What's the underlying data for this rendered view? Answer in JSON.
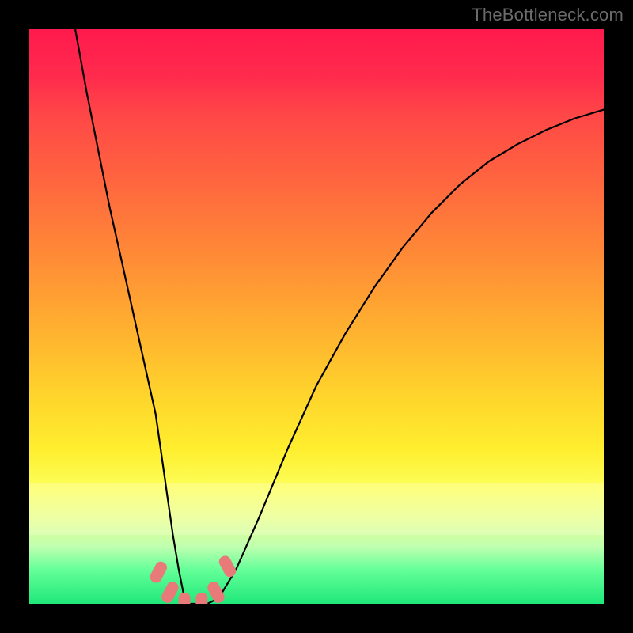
{
  "watermark": "TheBottleneck.com",
  "chart_data": {
    "type": "line",
    "title": "",
    "xlabel": "",
    "ylabel": "",
    "xlim": [
      0,
      100
    ],
    "ylim": [
      0,
      100
    ],
    "series": [
      {
        "name": "curve",
        "x": [
          8,
          10,
          12,
          14,
          16,
          18,
          20,
          22,
          23,
          24,
          25,
          26,
          27,
          28,
          29,
          30,
          31,
          33,
          36,
          40,
          45,
          50,
          55,
          60,
          65,
          70,
          75,
          80,
          85,
          90,
          95,
          100
        ],
        "values": [
          100,
          89,
          79,
          69,
          60,
          51,
          42,
          33,
          26,
          19,
          12,
          6,
          1,
          0,
          0,
          0,
          0,
          1,
          6,
          15,
          27,
          38,
          47,
          55,
          62,
          68,
          73,
          77,
          80,
          82.5,
          84.5,
          86
        ]
      }
    ],
    "markers": [
      {
        "x": 22.5,
        "y": 5.5
      },
      {
        "x": 24.5,
        "y": 2.0
      },
      {
        "x": 27.0,
        "y": 0.0
      },
      {
        "x": 30.0,
        "y": 0.0
      },
      {
        "x": 32.5,
        "y": 2.0
      },
      {
        "x": 34.5,
        "y": 6.5
      }
    ],
    "colors": {
      "curve": "#000000",
      "markers": "#e97a7a",
      "top": "#ff1a4d",
      "bottom": "#1fe87a"
    }
  }
}
